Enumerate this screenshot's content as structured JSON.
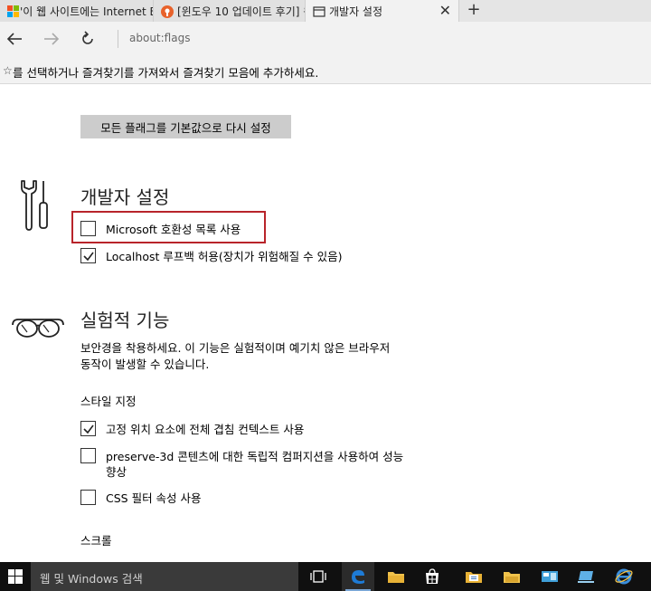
{
  "tabs": [
    {
      "title": "'이 웹 사이트에는 Internet E",
      "icon": "windows-logo-icon"
    },
    {
      "title": "[윈도우 10 업데이트 후기] 윈",
      "icon": "site-favicon-icon"
    },
    {
      "title": "개발자 설정",
      "icon": "page-icon",
      "active": true
    }
  ],
  "toolbar": {
    "address": "about:flags"
  },
  "favorites_bar": {
    "star": "☆",
    "text": "를 선택하거나 즐겨찾기를 가져와서 즐겨찾기 모음에 추가하세요."
  },
  "page": {
    "reset_button": "모든 플래그를 기본값으로 다시 설정",
    "developer": {
      "title": "개발자 설정",
      "options": [
        {
          "label": "Microsoft 호환성 목록 사용",
          "checked": false
        },
        {
          "label": "Localhost 루프백 허용(장치가 위험해질 수 있음)",
          "checked": true
        }
      ]
    },
    "experimental": {
      "title": "실험적 기능",
      "description": "보안경을 착용하세요. 이 기능은 실험적이며 예기치 않은 브라우저 동작이 발생할 수 있습니다.",
      "style_heading": "스타일 지정",
      "style_options": [
        {
          "label": "고정 위치 요소에 전체 겹침 컨텍스트 사용",
          "checked": true
        },
        {
          "label": "preserve-3d 콘텐츠에 대한 독립적 컴퍼지션을 사용하여 성능 향상",
          "checked": false
        },
        {
          "label": "CSS 필터 속성 사용",
          "checked": false
        }
      ],
      "scroll_heading": "스크롤"
    }
  },
  "taskbar": {
    "search_placeholder": "웹 및 Windows 검색",
    "pinned": [
      "task-view-icon",
      "edge-icon",
      "file-explorer-icon",
      "store-icon",
      "document-folder-icon",
      "folder-icon",
      "monitor-app-icon",
      "device-icon",
      "internet-explorer-icon"
    ]
  },
  "colors": {
    "highlight_border": "#b8242a",
    "taskbar": "#101010",
    "edge_blue": "#1e7bd6"
  }
}
